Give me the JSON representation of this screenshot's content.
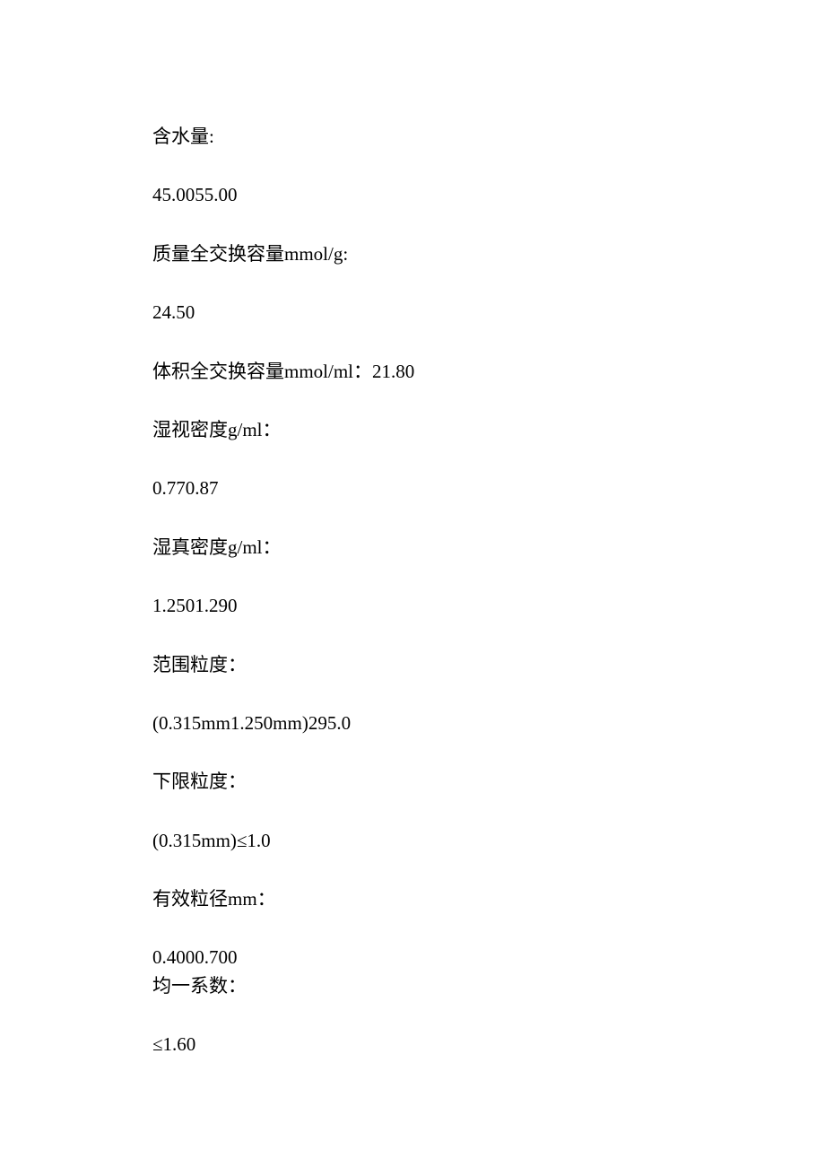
{
  "lines": [
    {
      "text": "含水量:",
      "tight": false
    },
    {
      "text": "45.0055.00",
      "tight": false
    },
    {
      "text": "质量全交换容量mmol/g:",
      "tight": false
    },
    {
      "text": "24.50",
      "tight": false
    },
    {
      "text": "体积全交换容量mmol/ml：21.80",
      "tight": false
    },
    {
      "text": "湿视密度g/ml：",
      "tight": false
    },
    {
      "text": "0.770.87",
      "tight": false
    },
    {
      "text": "湿真密度g/ml：",
      "tight": false
    },
    {
      "text": "1.2501.290",
      "tight": false
    },
    {
      "text": "范围粒度：",
      "tight": false
    },
    {
      "text": "(0.315mm1.250mm)295.0",
      "tight": false
    },
    {
      "text": "下限粒度：",
      "tight": false
    },
    {
      "text": "(0.315mm)≤1.0",
      "tight": false
    },
    {
      "text": "有效粒径mm：",
      "tight": false
    },
    {
      "text": "0.4000.700",
      "tight": true
    },
    {
      "text": "均一系数：",
      "tight": false
    },
    {
      "text": "≤1.60",
      "tight": false
    }
  ]
}
